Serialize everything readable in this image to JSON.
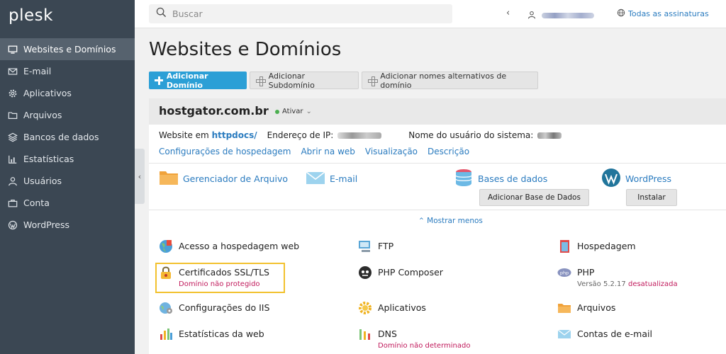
{
  "brand": {
    "logo": "plesk"
  },
  "sidebar": {
    "items": [
      {
        "label": "Websites e Domínios",
        "icon": "monitor-icon",
        "active": true
      },
      {
        "label": "E-mail",
        "icon": "envelope-icon"
      },
      {
        "label": "Aplicativos",
        "icon": "gear-icon"
      },
      {
        "label": "Arquivos",
        "icon": "folder-icon"
      },
      {
        "label": "Bancos de dados",
        "icon": "database-icon"
      },
      {
        "label": "Estatísticas",
        "icon": "bar-chart-icon"
      },
      {
        "label": "Usuários",
        "icon": "user-icon"
      },
      {
        "label": "Conta",
        "icon": "briefcase-icon"
      },
      {
        "label": "WordPress",
        "icon": "wordpress-icon"
      }
    ]
  },
  "topbar": {
    "search_placeholder": "Buscar",
    "subscriptions_label": "Todas as assinaturas"
  },
  "main": {
    "title": "Websites e Domínios",
    "buttons": {
      "add_domain": "Adicionar Domínio",
      "add_subdomain": "Adicionar Subdomínio",
      "add_alias": "Adicionar nomes alternativos de domínio"
    }
  },
  "domain": {
    "name": "hostgator.com.br",
    "status": "Ativar",
    "website_prefix": "Website em",
    "website_folder": "httpdocs/",
    "ip_label": "Endereço de IP:",
    "sysuser_label": "Nome do usuário do sistema:",
    "links": [
      "Configurações de hospedagem",
      "Abrir na web",
      "Visualização",
      "Descrição"
    ],
    "tools": {
      "file_manager": "Gerenciador de Arquivo",
      "email": "E-mail",
      "databases": "Bases de dados",
      "add_db_button": "Adicionar Base de Dados",
      "wordpress": "WordPress",
      "install_button": "Instalar"
    },
    "show_less": "Mostrar menos",
    "grid": {
      "web_access": "Acesso a hospedagem web",
      "ftp": "FTP",
      "hosting": "Hospedagem",
      "ssl": "Certificados SSL/TLS",
      "ssl_sub": "Domínio não protegido",
      "composer": "PHP Composer",
      "php": "PHP",
      "php_version": "Versão 5.2.17",
      "php_outdated": "desatualizada",
      "iis": "Configurações do IIS",
      "apps": "Aplicativos",
      "files": "Arquivos",
      "webstats": "Estatísticas da web",
      "dns": "DNS",
      "dns_sub": "Domínio não determinado",
      "mail_accounts": "Contas de e-mail"
    }
  },
  "colors": {
    "sidebar": "#3b4753",
    "accent": "#2b9fd6",
    "link": "#2a7bbf",
    "warning": "#c0195b",
    "highlight": "#f2c12e"
  }
}
